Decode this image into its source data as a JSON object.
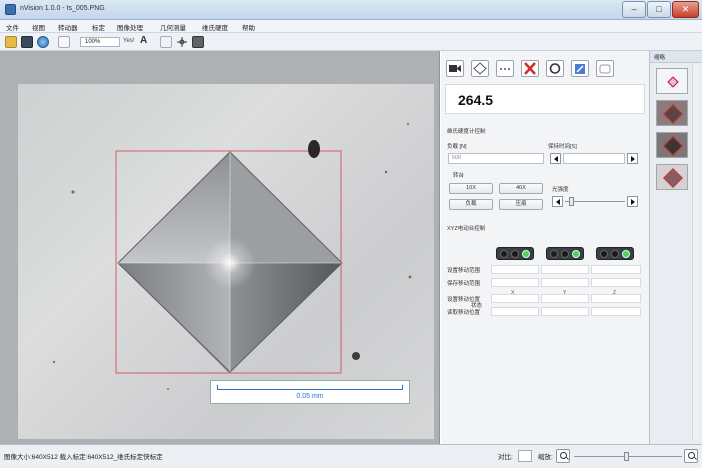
{
  "window": {
    "title": "nVision 1.0.0 - ts_005.PNG",
    "min_symbol": "–",
    "max_symbol": "□",
    "close_symbol": "✕"
  },
  "menu": [
    "文件",
    "视图",
    "转动器",
    "标定",
    "图像处理",
    "几何测量",
    "维氏硬度",
    "帮助"
  ],
  "toolbar": {
    "zoom": "100%",
    "zoom_suffix": "Yes!",
    "font_symbol": "A"
  },
  "image_panel": {
    "scale_label": "0.05 mm"
  },
  "control_panel": {
    "measurement_value": "264.5",
    "section_hardness": "维氏硬度计控制",
    "load_label": "负载 [N]",
    "load_value": "500",
    "dwell_label": "保持时间[S]",
    "objective_label": "转台",
    "btn_10x": "10X",
    "btn_40x": "40X",
    "btn_load": "负载",
    "btn_indent": "压痕",
    "brightness_label": "光强度",
    "section_stage": "XYZ电动台控制",
    "axis_x": "X",
    "axis_y": "Y",
    "axis_z": "Z",
    "row_status": "状态",
    "row_set_origin": "设置移动范围",
    "row_read_origin": "保存移动范围",
    "row_set_position": "设置移动位置",
    "row_read_position": "读取移动位置"
  },
  "thumbnails": {
    "header": "缩略"
  },
  "status_bar": {
    "text": "图像大小:640X512  载入标定:640X512_维氏标定快标定",
    "contrast_label": "对比:",
    "zoom_label": "缩放:"
  },
  "colors": {
    "selection_box": "#d65b66",
    "scale_blue": "#2a6fb8",
    "status_green": "#4cd06a"
  }
}
